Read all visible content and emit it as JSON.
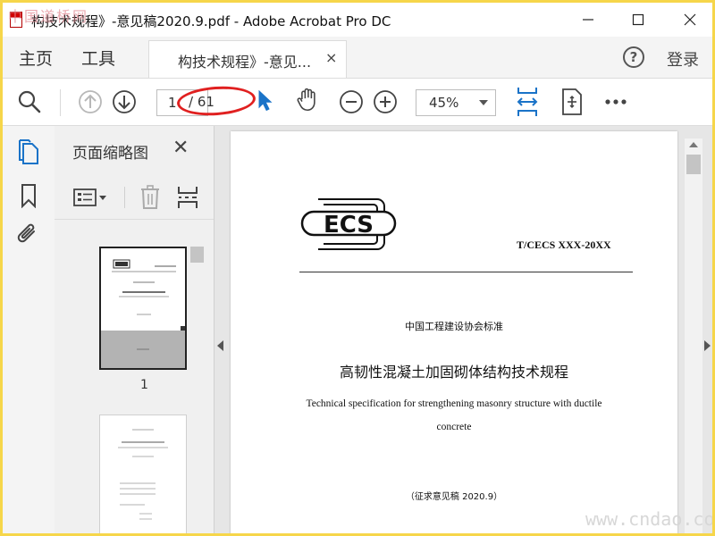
{
  "window": {
    "title": "构技术规程》-意见稿2020.9.pdf - Adobe Acrobat Pro DC",
    "watermark_top": "中国道桥网",
    "watermark_bottom": "www.cndao.com"
  },
  "menubar": {
    "home": "主页",
    "tools": "工具",
    "tab_label": "构技术规程》-意见...",
    "tab_close": "×",
    "help": "?",
    "login": "登录"
  },
  "toolbar": {
    "page_current": "1",
    "page_total": "/ 61",
    "zoom": "45%"
  },
  "thumbnails": {
    "title": "页面缩略图",
    "close": "✕",
    "page1_number": "1"
  },
  "document": {
    "std_code": "T/CECS XXX-20XX",
    "association": "中国工程建设协会标准",
    "title_cn": "高韧性混凝土加固砌体结构技术规程",
    "title_en_line1": "Technical specification for strengthening masonry structure with ductile",
    "title_en_line2": "concrete",
    "draft": "（征求意见稿 2020.9）",
    "logo_text": "ECS"
  },
  "colors": {
    "accent": "#1a73c8",
    "annotation_red": "#e02020",
    "frame_yellow": "#f6d64a"
  }
}
